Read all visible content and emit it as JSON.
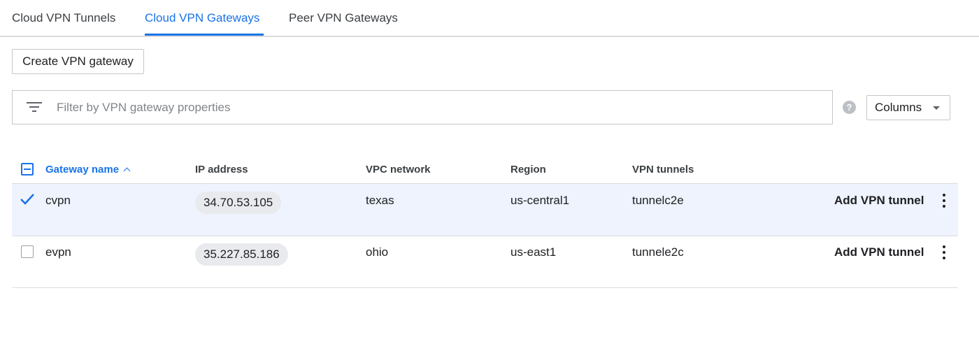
{
  "tabs": [
    {
      "label": "Cloud VPN Tunnels",
      "active": false
    },
    {
      "label": "Cloud VPN Gateways",
      "active": true
    },
    {
      "label": "Peer VPN Gateways",
      "active": false
    }
  ],
  "toolbar": {
    "create_label": "Create VPN gateway"
  },
  "filter": {
    "placeholder": "Filter by VPN gateway properties",
    "icon": "filter-icon"
  },
  "help": {
    "icon": "help-icon",
    "glyph": "?"
  },
  "columns_button": {
    "label": "Columns"
  },
  "table": {
    "headers": {
      "name": "Gateway name",
      "ip": "IP address",
      "network": "VPC network",
      "region": "Region",
      "tunnels": "VPN tunnels"
    },
    "sort_column": "Gateway name",
    "rows": [
      {
        "name": "cvpn",
        "ip": "34.70.53.105",
        "network": "texas",
        "region": "us-central1",
        "tunnels": "tunnelc2e",
        "action": "Add VPN tunnel",
        "selected": true
      },
      {
        "name": "evpn",
        "ip": "35.227.85.186",
        "network": "ohio",
        "region": "us-east1",
        "tunnels": "tunnele2c",
        "action": "Add VPN tunnel",
        "selected": false
      }
    ]
  },
  "colors": {
    "accent": "#1a73e8",
    "selected_row": "#eef3fd",
    "chip": "#e8eaed"
  }
}
